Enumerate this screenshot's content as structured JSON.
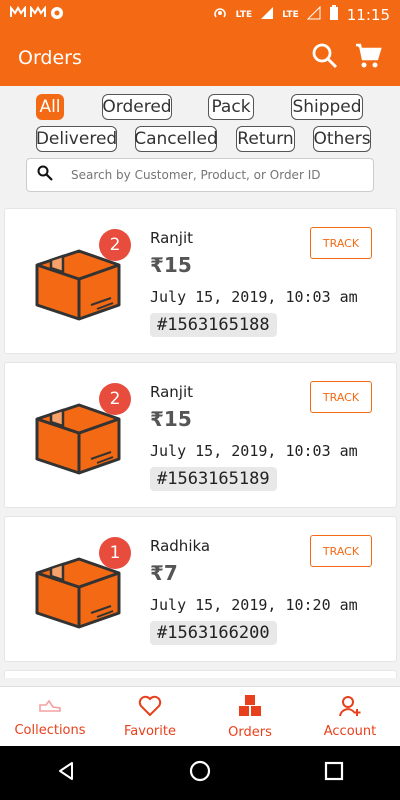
{
  "status_bar": {
    "left_icons": [
      "mail-icon",
      "mail-icon",
      "alert-icon"
    ],
    "lte1": "LTE",
    "lte2": "LTE",
    "battery_percent": "?",
    "time": "11:15"
  },
  "header": {
    "title": "Orders"
  },
  "filters": [
    {
      "label": "All",
      "active": true
    },
    {
      "label": "Ordered",
      "active": false
    },
    {
      "label": "Pack",
      "active": false
    },
    {
      "label": "Shipped",
      "active": false
    },
    {
      "label": "Delivered",
      "active": false
    },
    {
      "label": "Cancelled",
      "active": false
    },
    {
      "label": "Return",
      "active": false
    },
    {
      "label": "Others",
      "active": false
    }
  ],
  "search": {
    "placeholder": "Search by Customer, Product, or Order ID"
  },
  "orders": [
    {
      "count": "2",
      "customer": "Ranjit",
      "price": "₹15",
      "date": "July 15, 2019, 10:03 am",
      "order_id": "#1563165188",
      "track_label": "TRACK"
    },
    {
      "count": "2",
      "customer": "Ranjit",
      "price": "₹15",
      "date": "July 15, 2019, 10:03 am",
      "order_id": "#1563165189",
      "track_label": "TRACK"
    },
    {
      "count": "1",
      "customer": "Radhika",
      "price": "₹7",
      "date": "July 15, 2019, 10:20 am",
      "order_id": "#1563166200",
      "track_label": "TRACK"
    }
  ],
  "bottom_nav": [
    {
      "label": "Collections",
      "icon": "shoe-icon"
    },
    {
      "label": "Favorite",
      "icon": "heart-icon"
    },
    {
      "label": "Orders",
      "icon": "boxes-icon"
    },
    {
      "label": "Account",
      "icon": "add-user-icon"
    }
  ],
  "colors": {
    "brand": "#f46a14",
    "nav_text": "#e8401c",
    "badge": "#e74c3c"
  }
}
